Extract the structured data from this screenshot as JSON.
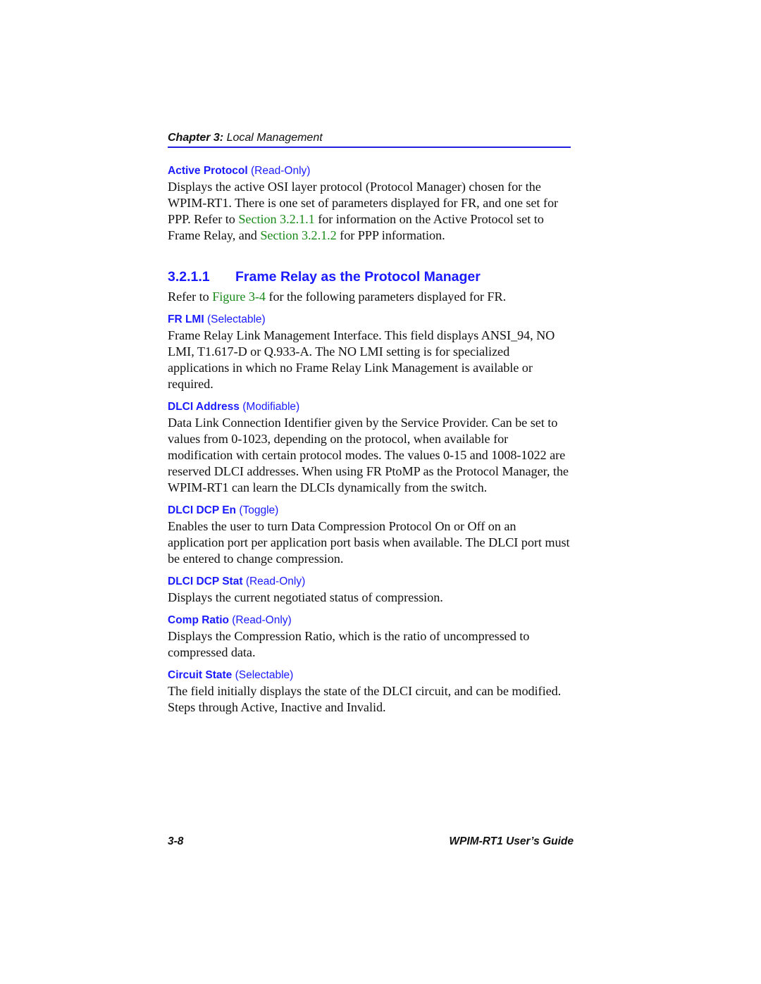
{
  "header": {
    "chapter_label": "Chapter 3:",
    "chapter_title": " Local Management"
  },
  "intro_param": {
    "name": "Active Protocol",
    "access": " (Read-Only)",
    "text_parts": [
      "Displays the active OSI layer protocol (Protocol Manager) chosen for the WPIM-RT1. There is one set of parameters displayed for FR, and one set for PPP. Refer to ",
      "Section 3.2.1.1",
      " for information on the Active Protocol set to Frame Relay, and ",
      "Section 3.2.1.2",
      " for PPP information."
    ]
  },
  "section": {
    "number": "3.2.1.1",
    "title": "Frame Relay as the Protocol Manager",
    "intro_parts": [
      "Refer to ",
      "Figure 3-4",
      " for the following parameters displayed for FR."
    ]
  },
  "params": [
    {
      "name": "FR LMI",
      "access": " (Selectable)",
      "text": "Frame Relay Link Management Interface. This field displays ANSI_94, NO LMI, T1.617-D or Q.933-A. The NO LMI setting is for specialized applications in which no Frame Relay Link Management is available or required."
    },
    {
      "name": "DLCI Address",
      "access": " (Modifiable)",
      "text": "Data Link Connection Identifier given by the Service Provider. Can be set to values from 0-1023, depending on the protocol, when available for modification with certain protocol modes. The values 0-15 and 1008-1022 are reserved DLCI addresses. When using FR PtoMP as the Protocol Manager, the WPIM-RT1 can learn the DLCIs dynamically from the switch."
    },
    {
      "name": "DLCI DCP En",
      "access": " (Toggle)",
      "text": "Enables the user to turn Data Compression Protocol On or Off on an application port per application port basis when available. The DLCI port must be entered to change compression."
    },
    {
      "name": "DLCI DCP Stat",
      "access": " (Read-Only)",
      "text": "Displays the current negotiated status of compression."
    },
    {
      "name": "Comp Ratio",
      "access": " (Read-Only)",
      "text": "Displays the Compression Ratio, which is the ratio of uncompressed to compressed data."
    },
    {
      "name": "Circuit State",
      "access": " (Selectable)",
      "text": "The field initially displays the state of the DLCI circuit, and can be modified. Steps through Active, Inactive and Invalid."
    }
  ],
  "footer": {
    "page_number": "3-8",
    "guide_title": "WPIM-RT1 User’s Guide"
  },
  "colors": {
    "heading_blue": "#1a1aff",
    "link_green": "#1a8a1a",
    "rule_blue": "#2020e0",
    "text": "#111111"
  }
}
